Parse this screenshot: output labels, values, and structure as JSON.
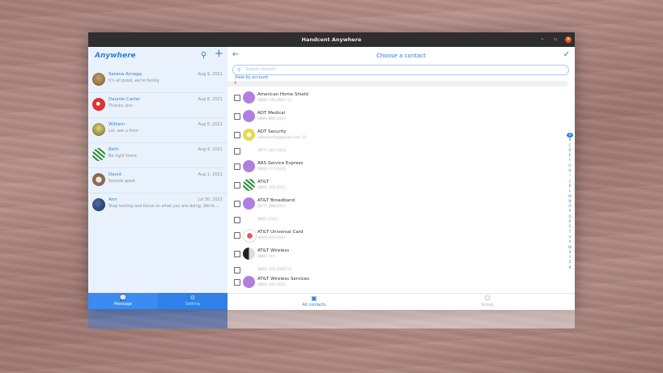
{
  "window": {
    "title": "Handcent Anywhere"
  },
  "sidebar": {
    "brand": "Anywhere",
    "conversations": [
      {
        "name": "Serena Arriaga",
        "preview": "It's all good, we're family.",
        "date": "Aug 9, 2021"
      },
      {
        "name": "Daunte Carter",
        "preview": "Thanks, bro.",
        "date": "Aug 8, 2021"
      },
      {
        "name": "William",
        "preview": "Lol, see u then",
        "date": "Aug 6, 2021"
      },
      {
        "name": "Beth",
        "preview": "Be right there.",
        "date": "Aug 4, 2021"
      },
      {
        "name": "David",
        "preview": "Sounds good.",
        "date": "Aug 1, 2021"
      },
      {
        "name": "Ann",
        "preview": "Stop testing and focus on what you are doing. We're ...",
        "date": "Jul 30, 2021"
      }
    ],
    "tabs": {
      "message": "Message",
      "setting": "Setting"
    }
  },
  "picker": {
    "title": "Choose a contact",
    "search_placeholder": "Search contact",
    "view_by_account": "View by account",
    "section_letter": "A",
    "contacts": [
      {
        "name": "American Home Shield",
        "phone": "(800) 776-4663 11"
      },
      {
        "name": "ADT Medical",
        "phone": "(800) 800-2311"
      },
      {
        "name": "ADT Security",
        "phone": "adtsecurity@gmail.com 11"
      },
      {
        "name": "",
        "phone": "(877) 345-2311"
      },
      {
        "name": "ARS Service Express",
        "phone": "(866) 277-8311"
      },
      {
        "name": "AT&T",
        "phone": "(800) 331-0511"
      },
      {
        "name": "AT&T Broadband",
        "phone": "(877) 288-8311"
      },
      {
        "name": "",
        "phone": "(800) 2311"
      },
      {
        "name": "AT&T Universal Card",
        "phone": "(800) 423-4311"
      },
      {
        "name": "AT&T Wireless",
        "phone": "(888) 311"
      },
      {
        "name": "",
        "phone": "(800) 331-0500 11"
      },
      {
        "name": "AT&T Wireless Services",
        "phone": "(800) 331-0511"
      }
    ],
    "alphabet": [
      "A",
      "B",
      "C",
      "D",
      "E",
      "F",
      "G",
      "H",
      "I",
      "J",
      "K",
      "L",
      "M",
      "N",
      "O",
      "P",
      "Q",
      "R",
      "S",
      "T",
      "U",
      "V",
      "W",
      "X",
      "Y",
      "Z",
      "#"
    ],
    "tabs": {
      "all_contacts": "All contacts",
      "group": "Group"
    }
  },
  "colors": {
    "accent": "#2f7fd6",
    "tab_bar": "#2f80e8"
  }
}
